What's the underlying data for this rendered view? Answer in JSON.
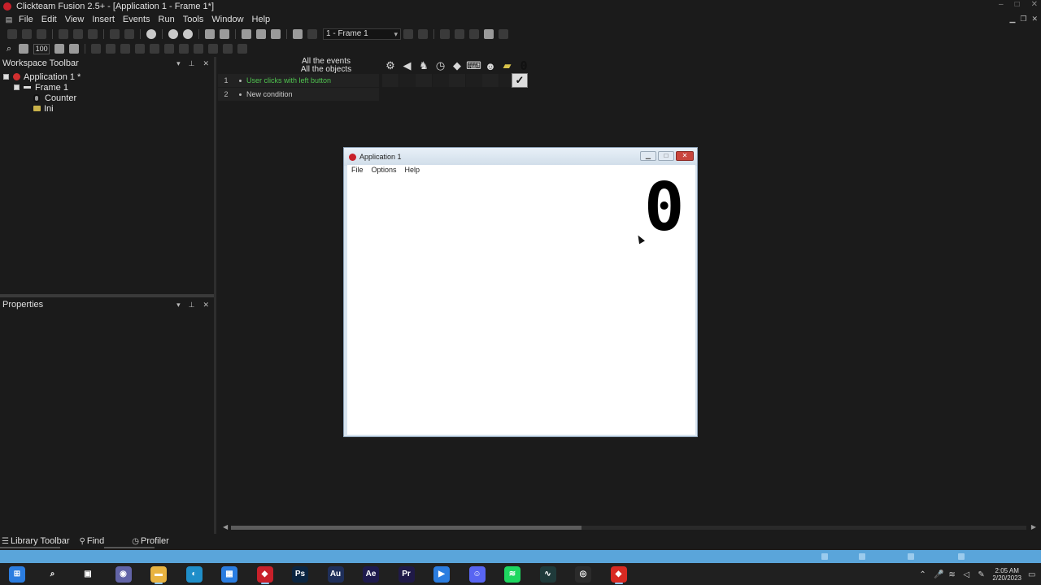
{
  "window": {
    "title": "Clickteam Fusion 2.5+ - [Application 1 - Frame 1*]",
    "controls": [
      "–",
      "□",
      "✕"
    ]
  },
  "menu": [
    "File",
    "Edit",
    "View",
    "Insert",
    "Events",
    "Run",
    "Tools",
    "Window",
    "Help"
  ],
  "toolbar": {
    "frame_select": "1 - Frame 1",
    "zoom": "100"
  },
  "workspace": {
    "title": "Workspace Toolbar",
    "tree": [
      {
        "label": "Application 1 *"
      },
      {
        "label": "Frame 1"
      },
      {
        "label": "Counter"
      },
      {
        "label": "Ini"
      }
    ]
  },
  "properties": {
    "title": "Properties"
  },
  "bottom_tabs": [
    "Library Toolbar",
    "Find",
    "Profiler"
  ],
  "event_editor": {
    "header_line1": "All the events",
    "header_line2": "All the objects",
    "rows": [
      {
        "num": "1",
        "text": "User clicks with left button",
        "highlight": true
      },
      {
        "num": "2",
        "text": "New condition",
        "highlight": false
      }
    ],
    "object_icons": [
      "special-conditions-icon",
      "sound-icon",
      "storyboard-icon",
      "timer-icon",
      "create-object-icon",
      "keyboard-mouse-icon",
      "player-icon",
      "ini-icon",
      "counter-icon"
    ]
  },
  "app_window": {
    "title": "Application 1",
    "menu": [
      "File",
      "Options",
      "Help"
    ],
    "counter_value": "0"
  },
  "taskbar": {
    "apps": [
      {
        "name": "start",
        "label": "",
        "color": "#2b7de0"
      },
      {
        "name": "search",
        "label": "",
        "color": "#202020"
      },
      {
        "name": "task-view",
        "label": "",
        "color": "#202020"
      },
      {
        "name": "teams",
        "label": "",
        "color": "#6264a7"
      },
      {
        "name": "file-explorer",
        "label": "",
        "color": "#e8b341"
      },
      {
        "name": "edge",
        "label": "",
        "color": "#1f8ec9"
      },
      {
        "name": "store",
        "label": "",
        "color": "#2b7de0"
      },
      {
        "name": "clickteam",
        "label": "",
        "color": "#c8202a"
      },
      {
        "name": "photoshop",
        "label": "Ps",
        "color": "#0b2541"
      },
      {
        "name": "audition",
        "label": "Au",
        "color": "#1f2f5a"
      },
      {
        "name": "after-effects",
        "label": "Ae",
        "color": "#1e1a4d"
      },
      {
        "name": "premiere",
        "label": "Pr",
        "color": "#1f1947"
      },
      {
        "name": "power-automate",
        "label": "",
        "color": "#2b7de0"
      },
      {
        "name": "discord",
        "label": "",
        "color": "#5865f2"
      },
      {
        "name": "spotify",
        "label": "",
        "color": "#1ed760"
      },
      {
        "name": "audio-app",
        "label": "",
        "color": "#1f3a3a"
      },
      {
        "name": "obs",
        "label": "",
        "color": "#2b2b2b"
      },
      {
        "name": "clickteam-runtime",
        "label": "",
        "color": "#d82a22"
      }
    ],
    "time": "2:05 AM",
    "date": "2/20/2023"
  }
}
